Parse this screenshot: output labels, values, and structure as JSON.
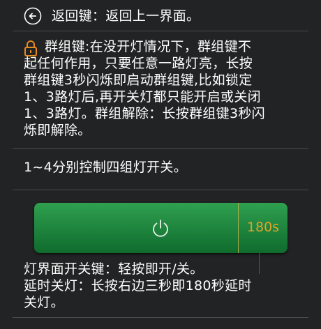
{
  "items": {
    "back": {
      "icon": "back-arrow-icon",
      "text": "返回键：返回上一界面。"
    },
    "group": {
      "icon": "lock-icon",
      "lines": [
        "群组键:在没开灯情况下，群组键不",
        "起任何作用，只要任意一路灯亮，长按",
        "群组键3秒闪烁即启动群组键,比如锁定",
        "1、3路灯后,再开关灯都只能开启或关闭",
        "1、3路灯。群组解除：长按群组键3秒闪",
        "烁即解除。"
      ]
    },
    "control": {
      "text": "1~4分别控制四组灯开关。"
    },
    "button": {
      "icon": "power-icon",
      "timer": "180s"
    },
    "switch_desc": {
      "lines": [
        "灯界面开关键：轻按即开/关。",
        "延时关灯：长按右边三秒即180秒延时",
        "关灯。"
      ]
    }
  },
  "colors": {
    "button_green": "#2fa04f",
    "lock_orange": "#e88a1e",
    "timer_orange": "#e3a22a"
  }
}
